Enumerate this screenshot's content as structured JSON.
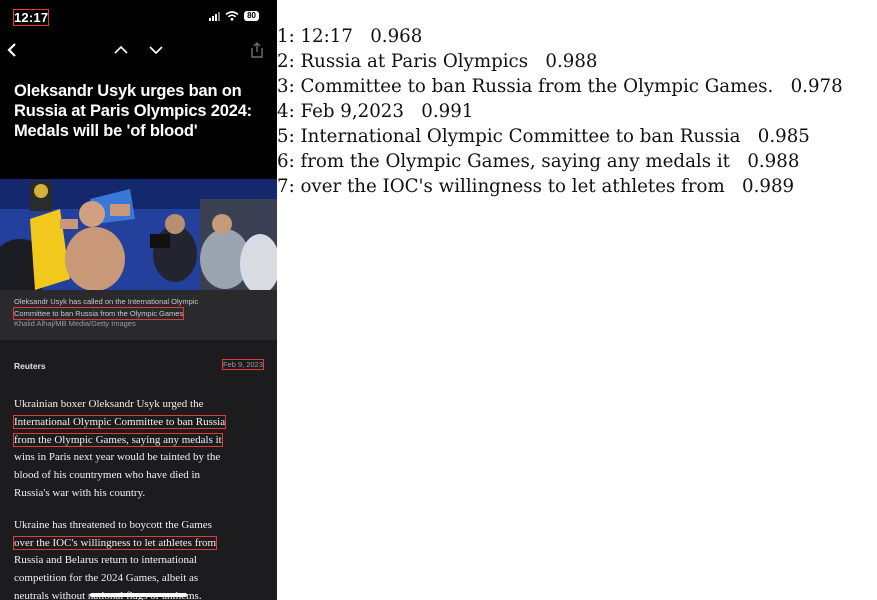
{
  "status_bar": {
    "time": "12:17",
    "battery": "80"
  },
  "nav": {
    "back_icon": "chevron-left-icon",
    "prev_icon": "chevron-up-icon",
    "next_icon": "chevron-down-icon",
    "share_icon": "share-icon"
  },
  "article": {
    "headline": "Oleksandr Usyk urges ban on Russia at Paris Olympics 2024: Medals will be 'of blood'",
    "caption_line1": "Oleksandr Usyk has called on the International Olympic",
    "caption_line2": "Committee to ban Russia from the Olympic Games",
    "credit": "Khalid Alhaj/MB Media/Getty Images",
    "source": "Reuters",
    "date": "Feb 9, 2023",
    "paragraph1_lines": [
      "Ukrainian boxer Oleksandr Usyk urged the",
      "International Olympic Committee to ban Russia",
      "from the Olympic Games, saying any medals it",
      "wins in Paris next year would be tainted by the",
      "blood of his countrymen who have died in",
      "Russia's war with his country."
    ],
    "paragraph2_lines": [
      "Ukraine has threatened to boycott the Games",
      "over the IOC's willingness to let athletes from",
      "Russia and Belarus return to international",
      "competition for the 2024 Games, albeit as",
      "neutrals without national flags or anthems."
    ]
  },
  "ocr_results": [
    "1: 12:17   0.968",
    "2: Russia at Paris Olympics   0.988",
    "3: Committee to ban Russia from the Olympic Games.   0.978",
    "4: Feb 9,2023   0.991",
    "5: International Olympic Committee to ban Russia   0.985",
    "6: from the Olympic Games, saying any medals it   0.988",
    "7: over the IOC's willingness to let athletes from   0.989"
  ],
  "colors": {
    "highlight_box": "#e53935",
    "phone_bg": "#1c1c1e",
    "header_bg": "#000000"
  }
}
